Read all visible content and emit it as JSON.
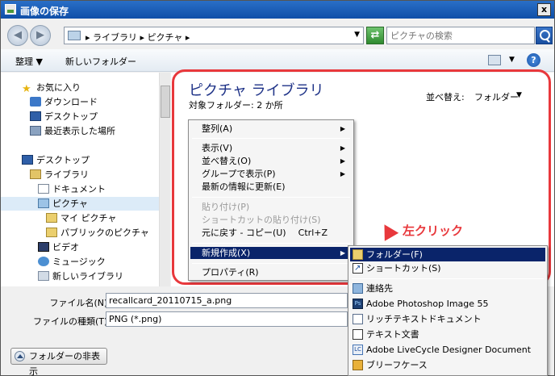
{
  "window": {
    "title": "画像の保存",
    "close_label": "x"
  },
  "address": {
    "crumbs": "▸ ライブラリ ▸ ピクチャ ▸",
    "search_placeholder": "ピクチャの検索"
  },
  "toolbar": {
    "organize": "整理 ▼",
    "new_folder": "新しいフォルダー",
    "help": "?"
  },
  "navpane": {
    "items": [
      {
        "label": "お気に入り",
        "icon": "star-icon"
      },
      {
        "label": "ダウンロード",
        "icon": "download-icon"
      },
      {
        "label": "デスクトップ",
        "icon": "desktop-icon"
      },
      {
        "label": "最近表示した場所",
        "icon": "recent-places-icon"
      },
      {
        "label": "デスクトップ",
        "icon": "desktop-icon"
      },
      {
        "label": "ライブラリ",
        "icon": "library-icon"
      },
      {
        "label": "ドキュメント",
        "icon": "documents-icon"
      },
      {
        "label": "ピクチャ",
        "icon": "pictures-icon"
      },
      {
        "label": "マイ ピクチャ",
        "icon": "folder-icon"
      },
      {
        "label": "パブリックのピクチャ",
        "icon": "folder-icon"
      },
      {
        "label": "ビデオ",
        "icon": "video-icon"
      },
      {
        "label": "ミュージック",
        "icon": "music-icon"
      },
      {
        "label": "新しいライブラリ",
        "icon": "new-library-icon"
      }
    ]
  },
  "content": {
    "library_title": "ピクチャ ライブラリ",
    "target_folders": "対象フォルダー: 2 か所",
    "sort_label": "並べ替え:",
    "sort_value": "フォルダー"
  },
  "context_menu": {
    "items": [
      {
        "label": "整列(A)"
      },
      {
        "label": "表示(V)"
      },
      {
        "label": "並べ替え(O)"
      },
      {
        "label": "グループで表示(P)"
      },
      {
        "label": "最新の情報に更新(E)"
      },
      {
        "label": "貼り付け(P)"
      },
      {
        "label": "ショートカットの貼り付け(S)"
      },
      {
        "label": "元に戻す - コピー(U)",
        "shortcut": "Ctrl+Z"
      },
      {
        "label": "新規作成(X)"
      },
      {
        "label": "プロパティ(R)"
      }
    ]
  },
  "submenu": {
    "items": [
      {
        "label": "フォルダー(F)",
        "icon": "folder-icon"
      },
      {
        "label": "ショートカット(S)",
        "icon": "shortcut-icon"
      },
      {
        "label": "連絡先",
        "icon": "contact-icon"
      },
      {
        "label": "Adobe Photoshop Image 55",
        "icon": "photoshop-icon",
        "glyph": "Ps"
      },
      {
        "label": "リッチテキストドキュメント",
        "icon": "rich-text-icon"
      },
      {
        "label": "テキスト文書",
        "icon": "text-document-icon"
      },
      {
        "label": "Adobe LiveCycle Designer Document",
        "icon": "livecycle-icon",
        "glyph": "LC"
      },
      {
        "label": "ブリーフケース",
        "icon": "briefcase-icon"
      }
    ]
  },
  "annotation": {
    "text": "左クリック"
  },
  "form": {
    "filename_label": "ファイル名(N):",
    "filename_value": "recallcard_20110715_a.png",
    "filetype_label": "ファイルの種類(T):",
    "filetype_value": "PNG (*.png)"
  },
  "footer": {
    "hide_folders": "フォルダーの非表示"
  },
  "colors": {
    "highlight": "#e8383c",
    "menu_active": "#0a246a",
    "title_blue": "#1e3287"
  }
}
